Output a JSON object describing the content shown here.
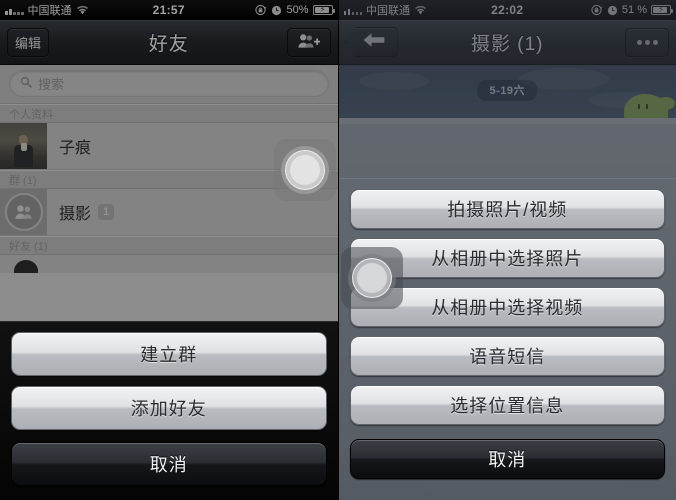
{
  "left_phone": {
    "status_bar": {
      "carrier": "中国联通",
      "time": "21:57",
      "battery_percent": "50%",
      "icons": [
        "signal-bars-icon",
        "wifi-icon",
        "rotation-lock-icon",
        "alarm-clock-icon",
        "battery-charging-icon"
      ]
    },
    "nav_bar": {
      "left_button": "编辑",
      "title": "好友",
      "right_button_icon": "add-friend-icon"
    },
    "search": {
      "placeholder": "搜索",
      "value": "",
      "icon": "search-icon"
    },
    "sections": [
      {
        "header": "个人资料",
        "rows": [
          {
            "label": "子痕",
            "badge": "",
            "avatar": "user-photo-avatar"
          }
        ]
      },
      {
        "header": "群 (1)",
        "rows": [
          {
            "label": "摄影",
            "badge": "1",
            "avatar": "group-icon"
          }
        ]
      },
      {
        "header": "好友 (1)",
        "rows": []
      }
    ],
    "action_sheet": {
      "buttons": [
        {
          "label": "建立群",
          "style": "light"
        },
        {
          "label": "添加好友",
          "style": "light"
        },
        {
          "label": "取消",
          "style": "dark"
        }
      ]
    },
    "touch_indicator": "touch-indicator"
  },
  "right_phone": {
    "status_bar": {
      "carrier": "中国联通",
      "time": "22:02",
      "battery_percent": "51 %",
      "icons": [
        "signal-bars-icon",
        "wifi-icon",
        "rotation-lock-icon",
        "alarm-clock-icon",
        "battery-charging-icon"
      ]
    },
    "nav_bar": {
      "back_icon": "back-arrow-icon",
      "title": "摄影 (1)",
      "right_button_icon": "more-dots-icon"
    },
    "chat": {
      "date_pill": "5-19六",
      "background": "sky-and-ground-wallpaper",
      "character": "green-creature"
    },
    "action_sheet": {
      "buttons": [
        {
          "label": "拍摄照片/视频",
          "style": "light"
        },
        {
          "label": "从相册中选择照片",
          "style": "light"
        },
        {
          "label": "从相册中选择视频",
          "style": "light"
        },
        {
          "label": "语音短信",
          "style": "light"
        },
        {
          "label": "选择位置信息",
          "style": "light"
        },
        {
          "label": "取消",
          "style": "dark"
        }
      ]
    },
    "touch_indicator": "touch-indicator"
  },
  "colors": {
    "navbar_dark": "#23262b",
    "sheet_light_button": "#dfe1e3",
    "sheet_dark_button": "#15171a",
    "chat_sky": "#45556a",
    "chat_ground": "#9aa0a7",
    "creature_green": "#8fae56"
  }
}
